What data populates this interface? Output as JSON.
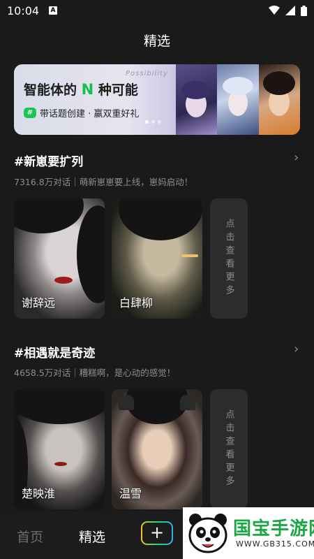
{
  "status_bar": {
    "time": "10:04",
    "notification_letter": "A"
  },
  "header": {
    "title": "精选"
  },
  "banner": {
    "headline_pre": "智能体的",
    "headline_highlight": "N",
    "headline_post": "种可能",
    "deco_text": "Possibility",
    "subtitle": "带话题创建 · 赢双重好礼",
    "chat_badge": "#",
    "active_dot": 0,
    "dot_count": 3
  },
  "sections": [
    {
      "title": "#新崽要扩列",
      "subtitle": "7316.8万对话｜萌新崽崽要上线，崽妈启动！",
      "cards": [
        {
          "name": "谢辞远"
        },
        {
          "name": "白肆柳"
        }
      ],
      "more": "点击查看更多"
    },
    {
      "title": "#相遇就是奇迹",
      "subtitle": "4658.5万对话｜糟糕啊，是心动的感觉！",
      "cards": [
        {
          "name": "楚映淮"
        },
        {
          "name": "温雪"
        }
      ],
      "more": "点击查看更多"
    }
  ],
  "bottom_nav": {
    "home": "首页",
    "featured": "精选",
    "add": "+"
  },
  "watermark": {
    "brand": "国宝手游网",
    "url": "WWW.GB315.COM"
  },
  "icons": {
    "chevron": "chevron-right-icon",
    "wifi": "wifi-icon",
    "signal": "signal-icon",
    "battery": "battery-icon"
  },
  "colors": {
    "accent_green": "#17c653",
    "background": "#1a1a1a",
    "muted_text": "#8d8d8d"
  }
}
